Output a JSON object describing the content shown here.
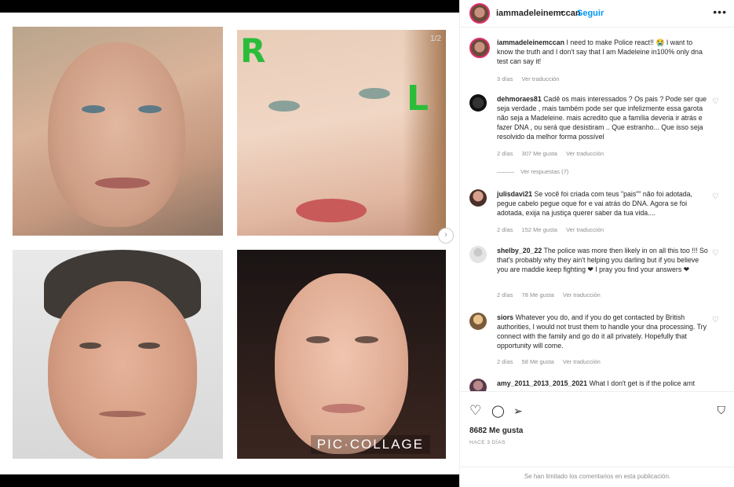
{
  "collage": {
    "label": "PIC·COLLAGE",
    "counter": "1/2",
    "annotation_left": "R",
    "annotation_right": "L"
  },
  "post": {
    "username": "iammadeleinemccan",
    "follow_label": "Seguir",
    "caption_user": "iammadeleinemccan",
    "caption_text": "I need to make Police react!! 😭 I want to know the truth and I don't say that I am Madeleine in100% only dna test can say it!",
    "caption_time": "3 días",
    "caption_translate": "Ver traducción",
    "likes": "8682 Me gusta",
    "posted_ago": "HACE 3 DÍAS",
    "comments_limited": "Se han limitado los comentarios en esta publicación."
  },
  "comments": [
    {
      "user": "dehmoraes81",
      "text": "Cadê os mais interessados ? Os pais ? Pode ser que seja verdade , mais também pode ser que infelizmente essa garota não seja a Madeleine. mais acredito que a família deveria ir atrás e fazer DNA , ou será que desistiram .. Que estranho... Que isso seja resolvido da melhor forma possível",
      "time": "2 días",
      "likes": "307 Me gusta",
      "translate": "Ver traducción",
      "replies": "Ver respuestas (7)"
    },
    {
      "user": "julisdavi21",
      "text": "Se você foi criada com teus \"pais\"\" não foi adotada, pegue cabelo pegue oque for e vai atrás do DNA. Agora se foi adotada, exija na justiça querer saber da tua vida....",
      "time": "2 días",
      "likes": "152 Me gusta",
      "translate": "Ver traducción"
    },
    {
      "user": "shelby_20_22",
      "text": "The police was more then likely in on all this too !!! So that's probably why they ain't helping you darling but if you believe you are maddie keep fighting ❤ I pray you find your answers ❤",
      "time": "2 días",
      "likes": "78 Me gusta",
      "translate": "Ver traducción"
    },
    {
      "user": "siors",
      "text": "Whatever you do, and if you do get contacted by British authorities, I would not trust them to handle your dna processing. Try connect with the family and go do it all privately. Hopefully that opportunity will come.",
      "time": "2 días",
      "likes": "58 Me gusta",
      "translate": "Ver traducción"
    },
    {
      "user": "amy_2011_2013_2015_2021",
      "text": "What I don't get is if the police arnt"
    }
  ]
}
